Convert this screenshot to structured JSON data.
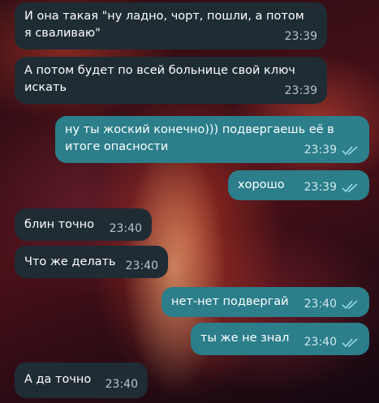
{
  "messages": [
    {
      "text": "И она такая \"ну ладно, чорт, пошли, а потом\nя сваливаю\"",
      "time": "23:39",
      "direction": "in"
    },
    {
      "text": "А потом будет по всей больнице свой ключ\nискать",
      "time": "23:39",
      "direction": "in"
    },
    {
      "text": "ну ты жоский конечно))) подвергаешь её в\nитоге опасности",
      "time": "23:39",
      "direction": "out",
      "status": "read"
    },
    {
      "text": "хорошо",
      "time": "23:39",
      "direction": "out",
      "status": "read"
    },
    {
      "text": "блин точно",
      "time": "23:40",
      "direction": "in"
    },
    {
      "text": "Что же делать",
      "time": "23:40",
      "direction": "in"
    },
    {
      "text": "нет-нет подвергай",
      "time": "23:40",
      "direction": "out",
      "status": "read"
    },
    {
      "text": "ты же не знал",
      "time": "23:40",
      "direction": "out",
      "status": "read"
    },
    {
      "text": "А да точно",
      "time": "23:40",
      "direction": "in"
    }
  ],
  "colors": {
    "incoming_bubble": "#1f2c34",
    "outgoing_bubble": "#2b7e8a",
    "read_check": "#8fd3e6"
  },
  "icons": {
    "read_status": "double-check-icon"
  }
}
